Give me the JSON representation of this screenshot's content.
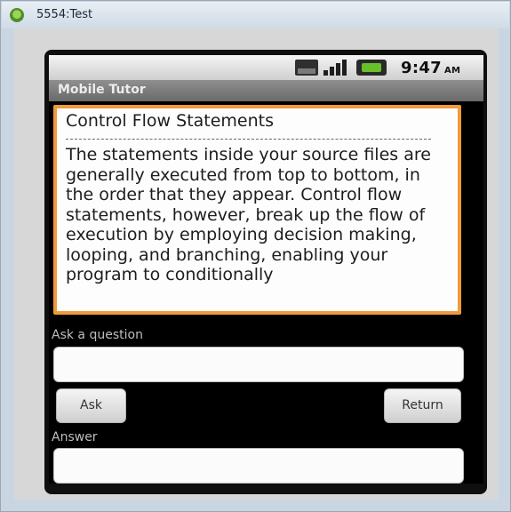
{
  "window": {
    "title": "5554:Test"
  },
  "statusbar": {
    "time": "9:47",
    "ampm": "AM"
  },
  "app": {
    "title": "Mobile Tutor"
  },
  "content": {
    "title": "Control Flow Statements",
    "body": "The statements inside your source files are generally executed from top to bottom, in the order that they appear. Control flow statements, however, break up the flow of execution by employing decision making, looping, and branching, enabling your program to conditionally"
  },
  "question": {
    "label": "Ask a question",
    "value": ""
  },
  "buttons": {
    "ask": "Ask",
    "return": "Return"
  },
  "answer": {
    "label": "Answer",
    "value": ""
  },
  "colors": {
    "accent": "#f09a3b",
    "battery": "#68c02a"
  }
}
